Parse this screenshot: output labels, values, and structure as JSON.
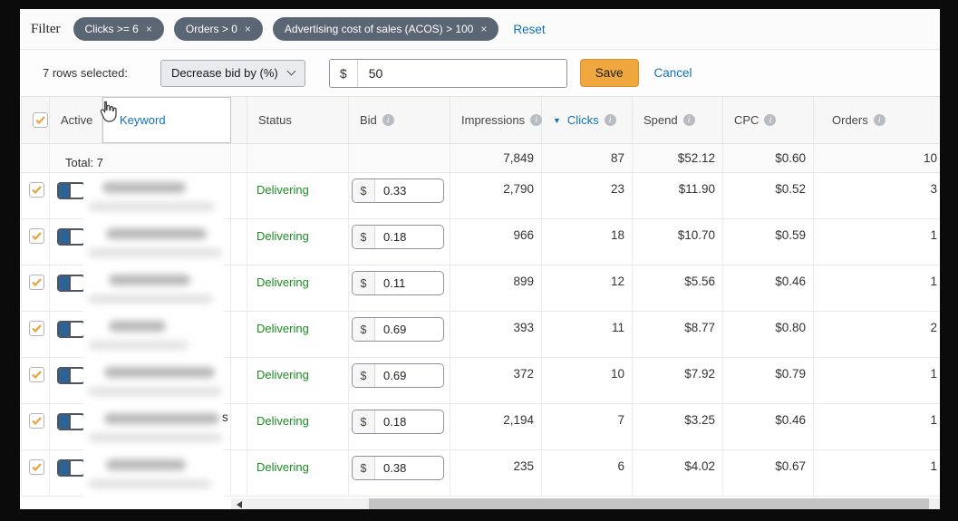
{
  "colors": {
    "link_blue": "#0f72b8",
    "chip_bg": "#5a6673",
    "save_orange": "#f0a73e",
    "status_green": "#1b8c21",
    "toggle_blue": "#2d6394",
    "checkbox_orange": "#e9a13b"
  },
  "filter_bar": {
    "label": "Filter",
    "chips": [
      {
        "label": "Clicks >= 6",
        "remove_icon": "×"
      },
      {
        "label": "Orders > 0",
        "remove_icon": "×"
      },
      {
        "label": "Advertising cost of sales (ACOS) > 100",
        "remove_icon": "×"
      }
    ],
    "reset_label": "Reset"
  },
  "bulk_bar": {
    "selected_text": "7 rows selected:",
    "action_label": "Decrease bid by (%)",
    "currency_symbol": "$",
    "value": "50",
    "save_label": "Save",
    "cancel_label": "Cancel"
  },
  "table": {
    "select_all_checked": true,
    "currency_symbol": "$",
    "headers": {
      "active": "Active",
      "keyword": "Keyword",
      "status": "Status",
      "bid": "Bid",
      "impressions": "Impressions",
      "clicks": "Clicks",
      "spend": "Spend",
      "cpc": "CPC",
      "orders": "Orders"
    },
    "sort": {
      "column": "clicks",
      "direction": "desc",
      "icon": "▼"
    },
    "total": {
      "label": "Total: 7",
      "impressions": "7,849",
      "clicks": "87",
      "spend": "$52.12",
      "cpc": "$0.60",
      "orders": "10"
    },
    "rows": [
      {
        "checked": true,
        "active": true,
        "keyword_redacted": true,
        "keyword_visible_suffix": "",
        "status": "Delivering",
        "bid": "0.33",
        "impressions": "2,790",
        "clicks": "23",
        "spend": "$11.90",
        "cpc": "$0.52",
        "orders": "3"
      },
      {
        "checked": true,
        "active": true,
        "keyword_redacted": true,
        "keyword_visible_suffix": "",
        "status": "Delivering",
        "bid": "0.18",
        "impressions": "966",
        "clicks": "18",
        "spend": "$10.70",
        "cpc": "$0.59",
        "orders": "1"
      },
      {
        "checked": true,
        "active": true,
        "keyword_redacted": true,
        "keyword_visible_suffix": "",
        "status": "Delivering",
        "bid": "0.11",
        "impressions": "899",
        "clicks": "12",
        "spend": "$5.56",
        "cpc": "$0.46",
        "orders": "1"
      },
      {
        "checked": true,
        "active": true,
        "keyword_redacted": true,
        "keyword_visible_suffix": "",
        "status": "Delivering",
        "bid": "0.69",
        "impressions": "393",
        "clicks": "11",
        "spend": "$8.77",
        "cpc": "$0.80",
        "orders": "2"
      },
      {
        "checked": true,
        "active": true,
        "keyword_redacted": true,
        "keyword_visible_suffix": "",
        "status": "Delivering",
        "bid": "0.69",
        "impressions": "372",
        "clicks": "10",
        "spend": "$7.92",
        "cpc": "$0.79",
        "orders": "1"
      },
      {
        "checked": true,
        "active": true,
        "keyword_redacted": true,
        "keyword_visible_suffix": "s",
        "status": "Delivering",
        "bid": "0.18",
        "impressions": "2,194",
        "clicks": "7",
        "spend": "$3.25",
        "cpc": "$0.46",
        "orders": "1"
      },
      {
        "checked": true,
        "active": true,
        "keyword_redacted": true,
        "keyword_visible_suffix": "",
        "status": "Delivering",
        "bid": "0.38",
        "impressions": "235",
        "clicks": "6",
        "spend": "$4.02",
        "cpc": "$0.67",
        "orders": "1"
      }
    ]
  }
}
